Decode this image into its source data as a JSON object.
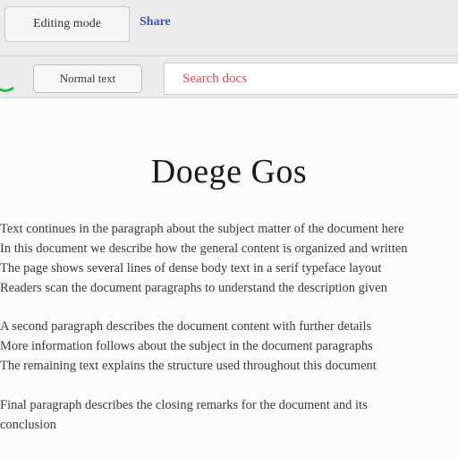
{
  "toolbar": {
    "field_label": "Editing mode",
    "tab_link": "Share"
  },
  "toolbar2": {
    "button_label": "Normal text",
    "search_text": "Search docs"
  },
  "document": {
    "title": "Doege Gos",
    "paragraphs": [
      {
        "lines": [
          "Text continues in the paragraph about the subject matter of the document here",
          "In this document we describe how the general content is organized and written",
          "The page shows several lines of dense body text in a serif typeface layout",
          "Readers scan the document paragraphs to understand the description given"
        ]
      },
      {
        "lines": [
          "A second paragraph describes the document content with further details",
          "More information follows about the subject in the document paragraphs",
          "The remaining text explains the structure used throughout this document"
        ]
      },
      {
        "lines": [
          "Final paragraph describes the closing remarks for the document and its",
          "conclusion"
        ]
      }
    ]
  },
  "colors": {
    "accent_blue": "#3a55b8",
    "search_red": "#e04848",
    "indicator_green": "#2ab84a"
  }
}
